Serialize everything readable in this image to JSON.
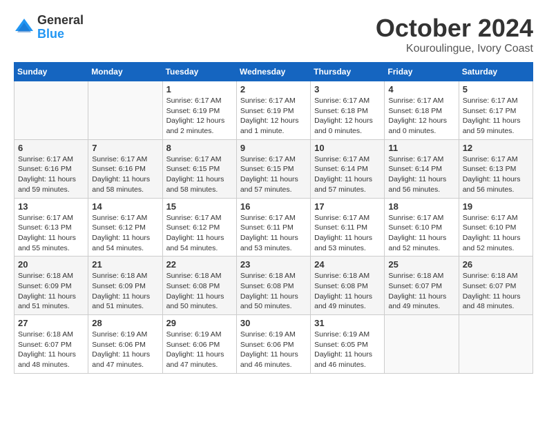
{
  "logo": {
    "general": "General",
    "blue": "Blue"
  },
  "title": "October 2024",
  "subtitle": "Kouroulingue, Ivory Coast",
  "days_header": [
    "Sunday",
    "Monday",
    "Tuesday",
    "Wednesday",
    "Thursday",
    "Friday",
    "Saturday"
  ],
  "weeks": [
    [
      {
        "day": "",
        "info": ""
      },
      {
        "day": "",
        "info": ""
      },
      {
        "day": "1",
        "info": "Sunrise: 6:17 AM\nSunset: 6:19 PM\nDaylight: 12 hours\nand 2 minutes."
      },
      {
        "day": "2",
        "info": "Sunrise: 6:17 AM\nSunset: 6:19 PM\nDaylight: 12 hours\nand 1 minute."
      },
      {
        "day": "3",
        "info": "Sunrise: 6:17 AM\nSunset: 6:18 PM\nDaylight: 12 hours\nand 0 minutes."
      },
      {
        "day": "4",
        "info": "Sunrise: 6:17 AM\nSunset: 6:18 PM\nDaylight: 12 hours\nand 0 minutes."
      },
      {
        "day": "5",
        "info": "Sunrise: 6:17 AM\nSunset: 6:17 PM\nDaylight: 11 hours\nand 59 minutes."
      }
    ],
    [
      {
        "day": "6",
        "info": "Sunrise: 6:17 AM\nSunset: 6:16 PM\nDaylight: 11 hours\nand 59 minutes."
      },
      {
        "day": "7",
        "info": "Sunrise: 6:17 AM\nSunset: 6:16 PM\nDaylight: 11 hours\nand 58 minutes."
      },
      {
        "day": "8",
        "info": "Sunrise: 6:17 AM\nSunset: 6:15 PM\nDaylight: 11 hours\nand 58 minutes."
      },
      {
        "day": "9",
        "info": "Sunrise: 6:17 AM\nSunset: 6:15 PM\nDaylight: 11 hours\nand 57 minutes."
      },
      {
        "day": "10",
        "info": "Sunrise: 6:17 AM\nSunset: 6:14 PM\nDaylight: 11 hours\nand 57 minutes."
      },
      {
        "day": "11",
        "info": "Sunrise: 6:17 AM\nSunset: 6:14 PM\nDaylight: 11 hours\nand 56 minutes."
      },
      {
        "day": "12",
        "info": "Sunrise: 6:17 AM\nSunset: 6:13 PM\nDaylight: 11 hours\nand 56 minutes."
      }
    ],
    [
      {
        "day": "13",
        "info": "Sunrise: 6:17 AM\nSunset: 6:13 PM\nDaylight: 11 hours\nand 55 minutes."
      },
      {
        "day": "14",
        "info": "Sunrise: 6:17 AM\nSunset: 6:12 PM\nDaylight: 11 hours\nand 54 minutes."
      },
      {
        "day": "15",
        "info": "Sunrise: 6:17 AM\nSunset: 6:12 PM\nDaylight: 11 hours\nand 54 minutes."
      },
      {
        "day": "16",
        "info": "Sunrise: 6:17 AM\nSunset: 6:11 PM\nDaylight: 11 hours\nand 53 minutes."
      },
      {
        "day": "17",
        "info": "Sunrise: 6:17 AM\nSunset: 6:11 PM\nDaylight: 11 hours\nand 53 minutes."
      },
      {
        "day": "18",
        "info": "Sunrise: 6:17 AM\nSunset: 6:10 PM\nDaylight: 11 hours\nand 52 minutes."
      },
      {
        "day": "19",
        "info": "Sunrise: 6:17 AM\nSunset: 6:10 PM\nDaylight: 11 hours\nand 52 minutes."
      }
    ],
    [
      {
        "day": "20",
        "info": "Sunrise: 6:18 AM\nSunset: 6:09 PM\nDaylight: 11 hours\nand 51 minutes."
      },
      {
        "day": "21",
        "info": "Sunrise: 6:18 AM\nSunset: 6:09 PM\nDaylight: 11 hours\nand 51 minutes."
      },
      {
        "day": "22",
        "info": "Sunrise: 6:18 AM\nSunset: 6:08 PM\nDaylight: 11 hours\nand 50 minutes."
      },
      {
        "day": "23",
        "info": "Sunrise: 6:18 AM\nSunset: 6:08 PM\nDaylight: 11 hours\nand 50 minutes."
      },
      {
        "day": "24",
        "info": "Sunrise: 6:18 AM\nSunset: 6:08 PM\nDaylight: 11 hours\nand 49 minutes."
      },
      {
        "day": "25",
        "info": "Sunrise: 6:18 AM\nSunset: 6:07 PM\nDaylight: 11 hours\nand 49 minutes."
      },
      {
        "day": "26",
        "info": "Sunrise: 6:18 AM\nSunset: 6:07 PM\nDaylight: 11 hours\nand 48 minutes."
      }
    ],
    [
      {
        "day": "27",
        "info": "Sunrise: 6:18 AM\nSunset: 6:07 PM\nDaylight: 11 hours\nand 48 minutes."
      },
      {
        "day": "28",
        "info": "Sunrise: 6:19 AM\nSunset: 6:06 PM\nDaylight: 11 hours\nand 47 minutes."
      },
      {
        "day": "29",
        "info": "Sunrise: 6:19 AM\nSunset: 6:06 PM\nDaylight: 11 hours\nand 47 minutes."
      },
      {
        "day": "30",
        "info": "Sunrise: 6:19 AM\nSunset: 6:06 PM\nDaylight: 11 hours\nand 46 minutes."
      },
      {
        "day": "31",
        "info": "Sunrise: 6:19 AM\nSunset: 6:05 PM\nDaylight: 11 hours\nand 46 minutes."
      },
      {
        "day": "",
        "info": ""
      },
      {
        "day": "",
        "info": ""
      }
    ]
  ]
}
